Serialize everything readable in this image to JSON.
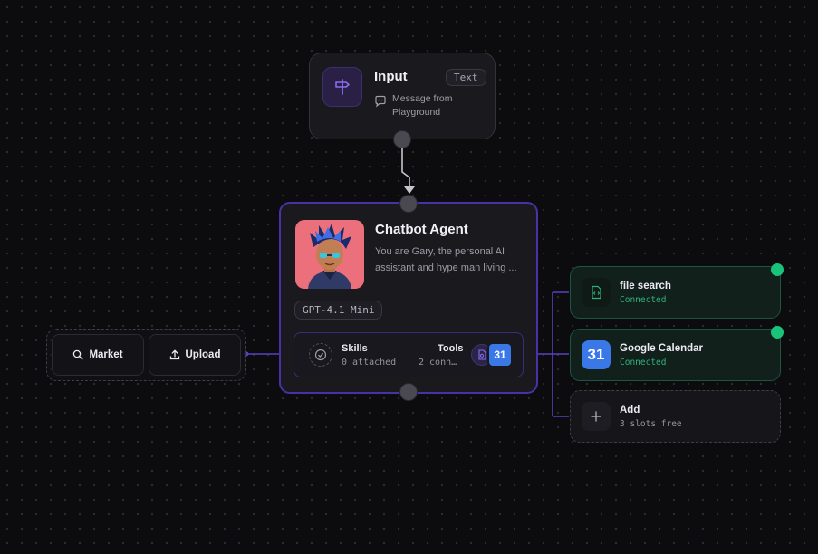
{
  "input_node": {
    "title": "Input",
    "badge": "Text",
    "message": "Message from Playground"
  },
  "agent_node": {
    "title": "Chatbot Agent",
    "description": "You are Gary, the personal AI assistant and hype man living ...",
    "model": "GPT-4.1 Mini",
    "skills": {
      "label": "Skills",
      "sub": "0 attached"
    },
    "tools": {
      "label": "Tools",
      "sub": "2 conn…",
      "calendar_chip": "31"
    }
  },
  "left_buttons": {
    "market": "Market",
    "upload": "Upload"
  },
  "tool_cards": [
    {
      "title": "file search",
      "status": "Connected"
    },
    {
      "title": "Google Calendar",
      "status": "Connected",
      "icon_text": "31"
    }
  ],
  "add_card": {
    "title": "Add",
    "sub": "3 slots free"
  },
  "colors": {
    "accent": "#4b31a6",
    "connected": "#19c47a",
    "calendar_blue": "#3a78e8"
  }
}
